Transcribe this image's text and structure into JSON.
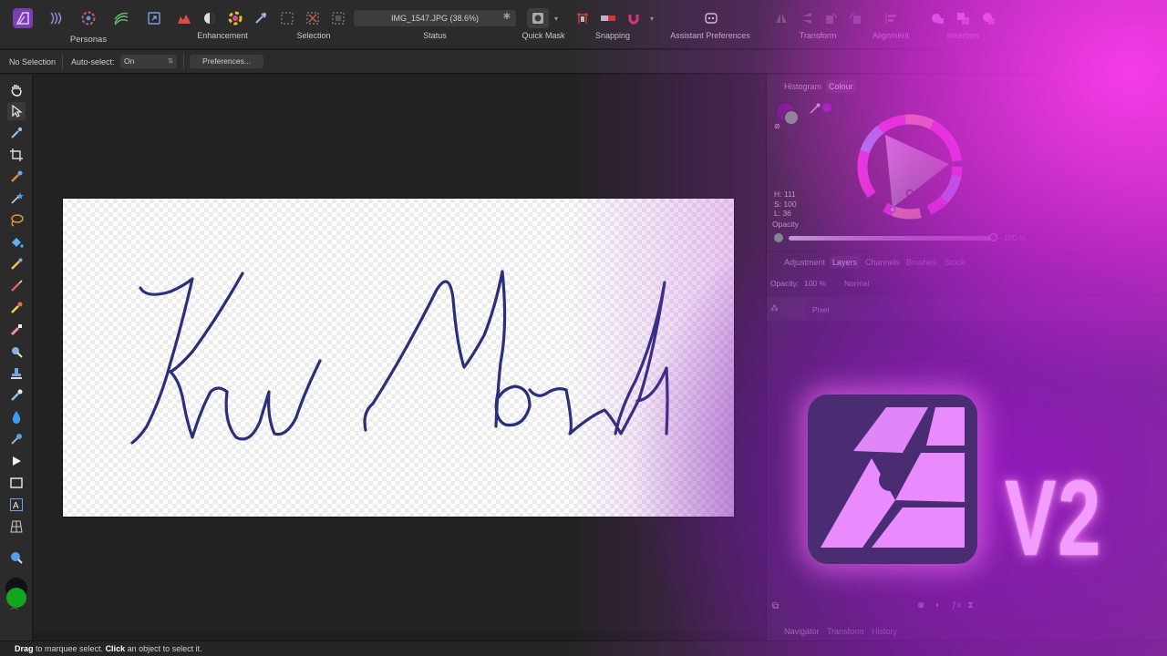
{
  "toolbar": {
    "personas_label": "Personas",
    "enhancement_label": "Enhancement",
    "selection_label": "Selection",
    "status_label": "Status",
    "status_value": "IMG_1547.JPG (38.6%)",
    "quickmask_label": "Quick Mask",
    "snapping_label": "Snapping",
    "assistant_label": "Assistant Preferences",
    "transform_label": "Transform",
    "alignment_label": "Alignment",
    "insertion_label": "Insertion"
  },
  "context": {
    "selection_state": "No Selection",
    "auto_select_label": "Auto-select:",
    "auto_select_value": "On",
    "preferences_button": "Preferences..."
  },
  "colour_panel": {
    "tabs": [
      "Histogram",
      "Colour"
    ],
    "h": "H: 111",
    "s": "S: 100",
    "l": "L: 36",
    "opacity_label": "Opacity",
    "opacity_value": "100 %"
  },
  "layers_panel": {
    "tabs": [
      "Adjustment",
      "Layers",
      "Channels",
      "Brushes",
      "Stock"
    ],
    "opacity_label": "Opacity:",
    "opacity_value": "100 %",
    "blend_mode": "Normal",
    "layer_name": "Pixel"
  },
  "bottom_tabs": [
    "Navigator",
    "Transform",
    "History"
  ],
  "statusbar": {
    "drag": "Drag",
    "drag_text": " to marquee select. ",
    "click": "Click",
    "click_text": " an object to select it."
  },
  "overlay": {
    "version_text": "V2"
  },
  "colors": {
    "primary_fill": "#12a51f",
    "accent_magenta": "#ff3cf0",
    "signature_ink": "#2a2f7a",
    "selected_colour": "#5b1a6e",
    "secondary_colour": "#6ebf6e"
  }
}
